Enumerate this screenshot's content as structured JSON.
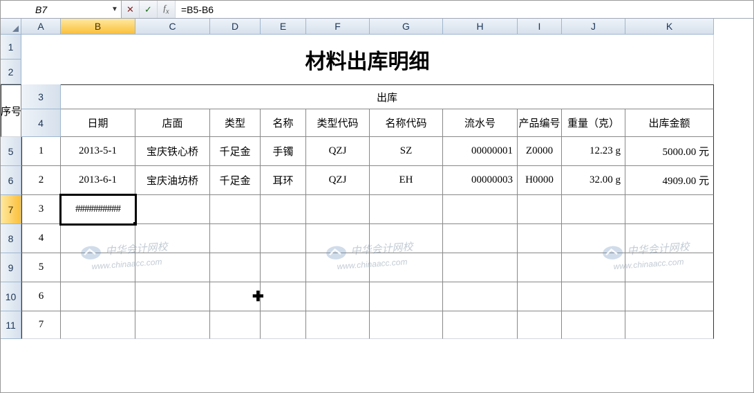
{
  "name_box": "B7",
  "formula": "=B5-B6",
  "columns": [
    "A",
    "B",
    "C",
    "D",
    "E",
    "F",
    "G",
    "H",
    "I",
    "J",
    "K"
  ],
  "row_numbers": [
    1,
    2,
    3,
    4,
    5,
    6,
    7,
    8,
    9,
    10,
    11
  ],
  "title": "材料出库明细",
  "header": {
    "seq": "序号",
    "outbound": "出库",
    "date": "日期",
    "shop": "店面",
    "type": "类型",
    "name": "名称",
    "type_code": "类型代码",
    "name_code": "名称代码",
    "serial": "流水号",
    "prod_no": "产品编号",
    "weight": "重量（克）",
    "amount": "出库金额"
  },
  "rows": [
    {
      "seq": "1",
      "date": "2013-5-1",
      "shop": "宝庆铁心桥",
      "type": "千足金",
      "name": "手镯",
      "type_code": "QZJ",
      "name_code": "SZ",
      "serial": "00000001",
      "prod_no": "Z0000",
      "weight": "12.23 g",
      "amount": "5000.00 元"
    },
    {
      "seq": "2",
      "date": "2013-6-1",
      "shop": "宝庆油坊桥",
      "type": "千足金",
      "name": "耳环",
      "type_code": "QZJ",
      "name_code": "EH",
      "serial": "00000003",
      "prod_no": "H0000",
      "weight": "32.00 g",
      "amount": "4909.00 元"
    },
    {
      "seq": "3",
      "date": "##########",
      "shop": "",
      "type": "",
      "name": "",
      "type_code": "",
      "name_code": "",
      "serial": "",
      "prod_no": "",
      "weight": "",
      "amount": ""
    },
    {
      "seq": "4"
    },
    {
      "seq": "5"
    },
    {
      "seq": "6"
    },
    {
      "seq": "7"
    }
  ],
  "active_cell": "B7",
  "watermark_cn": "中华会计网校",
  "watermark_en": "www.chinaacc.com"
}
